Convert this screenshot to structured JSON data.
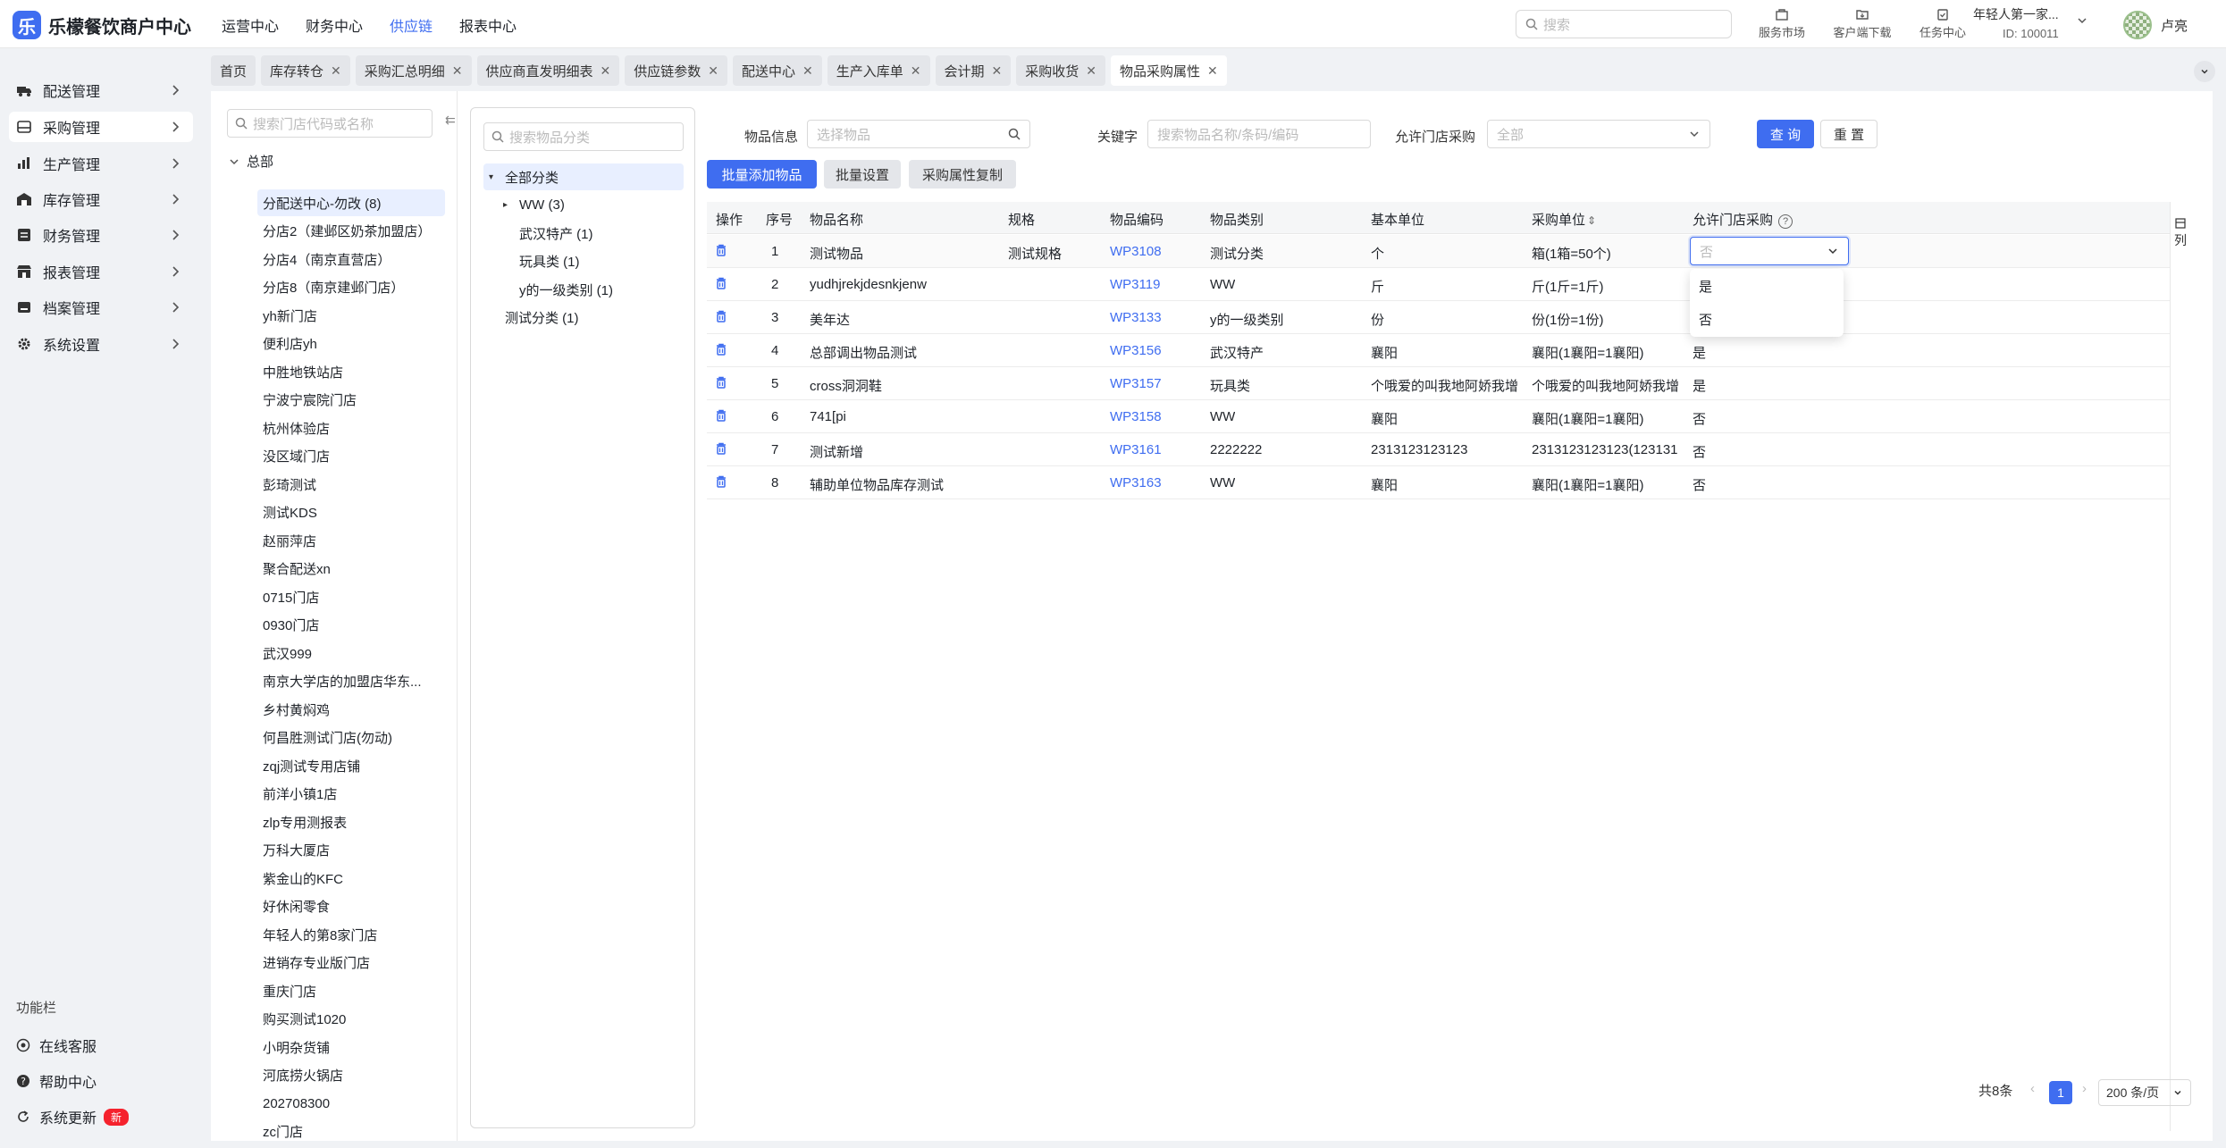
{
  "app": {
    "logo_letter": "乐",
    "title": "乐檬餐饮商户中心"
  },
  "top_nav": [
    "运营中心",
    "财务中心",
    "供应链",
    "报表中心"
  ],
  "top_search": {
    "placeholder": "搜索"
  },
  "top_tools": [
    "服务市场",
    "客户端下载",
    "任务中心"
  ],
  "account": {
    "name": "年轻人第一家...",
    "id": "ID: 100011"
  },
  "user": {
    "name": "卢亮"
  },
  "sidebar": {
    "items": [
      {
        "label": "配送管理",
        "icon": "truck-icon"
      },
      {
        "label": "采购管理",
        "icon": "purchase-icon"
      },
      {
        "label": "生产管理",
        "icon": "chart-icon"
      },
      {
        "label": "库存管理",
        "icon": "warehouse-icon"
      },
      {
        "label": "财务管理",
        "icon": "finance-icon"
      },
      {
        "label": "报表管理",
        "icon": "report-icon"
      },
      {
        "label": "档案管理",
        "icon": "archive-icon"
      },
      {
        "label": "系统设置",
        "icon": "gear-icon"
      }
    ],
    "function_title": "功能栏",
    "functions": [
      {
        "label": "在线客服"
      },
      {
        "label": "帮助中心"
      },
      {
        "label": "系统更新",
        "badge": "新"
      }
    ]
  },
  "tabs": [
    "首页",
    "库存转仓",
    "采购汇总明细",
    "供应商直发明细表",
    "供应链参数",
    "配送中心",
    "生产入库单",
    "会计期",
    "采购收货",
    "物品采购属性"
  ],
  "store_panel": {
    "search_placeholder": "搜索门店代码或名称",
    "collapse_glyph": "⇇",
    "root": "总部",
    "stores": [
      "分配送中心-勿改 (8)",
      "分店2（建邺区奶茶加盟店）",
      "分店4（南京直营店）",
      "分店8（南京建邺门店）",
      "yh新门店",
      "便利店yh",
      "中胜地铁站店",
      "宁波宁宸院门店",
      "杭州体验店",
      "没区域门店",
      "彭琦测试",
      "测试KDS",
      "赵丽萍店",
      "聚合配送xn",
      "0715门店",
      "0930门店",
      "武汉999",
      "南京大学店的加盟店华东...",
      "乡村黄焖鸡",
      "何昌胜测试门店(勿动)",
      "zqj测试专用店铺",
      "前洋小镇1店",
      "zlp专用测报表",
      "万科大厦店",
      "紫金山的KFC",
      "好休闲零食",
      "年轻人的第8家门店",
      "进销存专业版门店",
      "重庆门店",
      "购买测试1020",
      "小明杂货铺",
      "河底捞火锅店",
      "202708300",
      "zc门店"
    ]
  },
  "category_panel": {
    "search_placeholder": "搜索物品分类",
    "rows": [
      {
        "label": "全部分类",
        "level": 0,
        "expander": "▾"
      },
      {
        "label": "WW (3)",
        "level": 1,
        "expander": "▸"
      },
      {
        "label": "武汉特产 (1)",
        "level": 1,
        "expander": ""
      },
      {
        "label": "玩具类 (1)",
        "level": 1,
        "expander": ""
      },
      {
        "label": "y的一级类别 (1)",
        "level": 1,
        "expander": ""
      },
      {
        "label": "测试分类 (1)",
        "level": 0,
        "expander": ""
      }
    ]
  },
  "filters": {
    "item_info_label": "物品信息",
    "item_info_placeholder": "选择物品",
    "keyword_label": "关键字",
    "keyword_placeholder": "搜索物品名称/条码/编码",
    "allow_label": "允许门店采购",
    "allow_placeholder": "全部",
    "query_button": "查 询",
    "reset_button": "重 置"
  },
  "actions": {
    "batch_add": "批量添加物品",
    "batch_set": "批量设置",
    "copy_attr": "采购属性复制"
  },
  "table": {
    "headers": [
      "操作",
      "序号",
      "物品名称",
      "规格",
      "物品编码",
      "物品类别",
      "基本单位",
      "采购单位",
      "允许门店采购"
    ],
    "sort_glyph": "⇕",
    "help_glyph": "?",
    "rows": [
      {
        "no": "1",
        "name": "测试物品",
        "spec": "测试规格",
        "code": "WP3108",
        "category": "测试分类",
        "base_unit": "个",
        "purchase_unit": "箱(1箱=50个)",
        "allow": ""
      },
      {
        "no": "2",
        "name": "yudhjrekjdesnkjenw",
        "spec": "",
        "code": "WP3119",
        "category": "WW",
        "base_unit": "斤",
        "purchase_unit": "斤(1斤=1斤)",
        "allow": ""
      },
      {
        "no": "3",
        "name": "美年达",
        "spec": "",
        "code": "WP3133",
        "category": "y的一级类别",
        "base_unit": "份",
        "purchase_unit": "份(1份=1份)",
        "allow": ""
      },
      {
        "no": "4",
        "name": "总部调出物品测试",
        "spec": "",
        "code": "WP3156",
        "category": "武汉特产",
        "base_unit": "襄阳",
        "purchase_unit": "襄阳(1襄阳=1襄阳)",
        "allow": "是"
      },
      {
        "no": "5",
        "name": "cross洞洞鞋",
        "spec": "",
        "code": "WP3157",
        "category": "玩具类",
        "base_unit": "个哦爱的叫我地阿娇我增",
        "purchase_unit": "个哦爱的叫我地阿娇我增",
        "allow": "是"
      },
      {
        "no": "6",
        "name": "741[pi",
        "spec": "",
        "code": "WP3158",
        "category": "WW",
        "base_unit": "襄阳",
        "purchase_unit": "襄阳(1襄阳=1襄阳)",
        "allow": "否"
      },
      {
        "no": "7",
        "name": "测试新增",
        "spec": "",
        "code": "WP3161",
        "category": "2222222",
        "base_unit": "2313123123123",
        "purchase_unit": "2313123123123(123131",
        "allow": "否"
      },
      {
        "no": "8",
        "name": "辅助单位物品库存测试",
        "spec": "",
        "code": "WP3163",
        "category": "WW",
        "base_unit": "襄阳",
        "purchase_unit": "襄阳(1襄阳=1襄阳)",
        "allow": "否"
      }
    ],
    "column_settings": "列"
  },
  "row_select": {
    "value": "否",
    "options": [
      "是",
      "否"
    ]
  },
  "pagination": {
    "total": "共8条",
    "prev": "‹",
    "page": "1",
    "next": "›",
    "page_size": "200 条/页"
  },
  "colors": {
    "primary": "#3f6df0",
    "sidebar_bg": "#f0f2f5",
    "badge": "#f5222d"
  }
}
